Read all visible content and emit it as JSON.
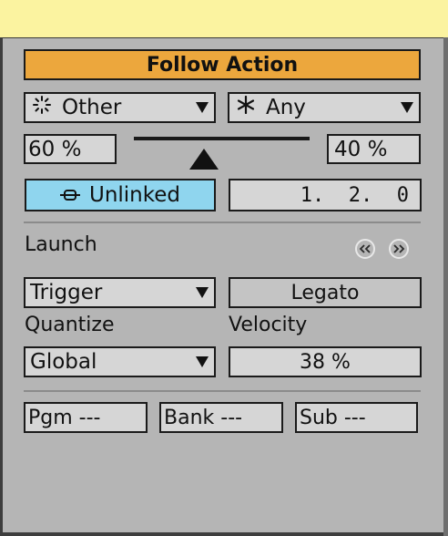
{
  "header": {
    "title": "Follow Action"
  },
  "follow_action": {
    "action_a": "Other",
    "action_b": "Any",
    "chance_a": "60 %",
    "chance_b": "40 %",
    "link_label": "Unlinked",
    "time_position": "1.  2.  0"
  },
  "launch": {
    "label": "Launch",
    "mode": "Trigger",
    "legato_label": "Legato",
    "quantize_label": "Quantize",
    "quantize_value": "Global",
    "velocity_label": "Velocity",
    "velocity_value": "38 %"
  },
  "program": {
    "pgm": "Pgm ---",
    "bank": "Bank ---",
    "sub": "Sub ---"
  },
  "colors": {
    "header_bg": "#eca73d",
    "unlinked_bg": "#8fd5ee",
    "top_bar": "#fbf3a0",
    "panel_bg": "#b5b5b5"
  },
  "icons": {
    "action_a": "other-burst-icon",
    "action_b": "any-asterisk-icon",
    "link": "link-chain-icon",
    "nav_prev": "previous-rewind-icon",
    "nav_next": "next-forward-icon"
  }
}
